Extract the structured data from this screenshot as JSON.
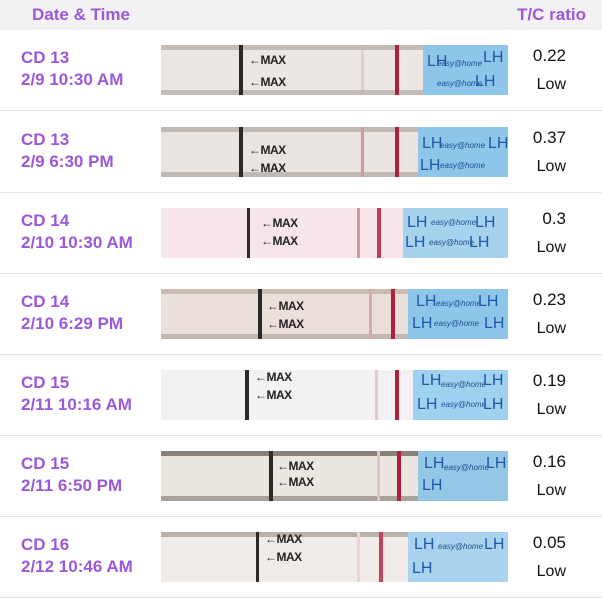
{
  "header": {
    "date_label": "Date & Time",
    "ratio_label": "T/C ratio"
  },
  "strip_text": {
    "max_label": "←MAX",
    "lh_label": "LH",
    "brand_label": "easy@home"
  },
  "colors": {
    "accent": "#9b59d8",
    "control_line": "#b0203a",
    "test_line": "#e0a7b2",
    "wrapper": "#8ec6ea"
  },
  "entries": [
    {
      "cd": "CD 13",
      "datetime": "2/9 10:30 AM",
      "ratio": "0.22",
      "status": "Low"
    },
    {
      "cd": "CD 13",
      "datetime": "2/9 6:30 PM",
      "ratio": "0.37",
      "status": "Low"
    },
    {
      "cd": "CD 14",
      "datetime": "2/10 10:30 AM",
      "ratio": "0.3",
      "status": "Low"
    },
    {
      "cd": "CD 14",
      "datetime": "2/10 6:29 PM",
      "ratio": "0.23",
      "status": "Low"
    },
    {
      "cd": "CD 15",
      "datetime": "2/11 10:16 AM",
      "ratio": "0.19",
      "status": "Low"
    },
    {
      "cd": "CD 15",
      "datetime": "2/11 6:50 PM",
      "ratio": "0.16",
      "status": "Low"
    },
    {
      "cd": "CD 16",
      "datetime": "2/12 10:46 AM",
      "ratio": "0.05",
      "status": "Low"
    }
  ]
}
